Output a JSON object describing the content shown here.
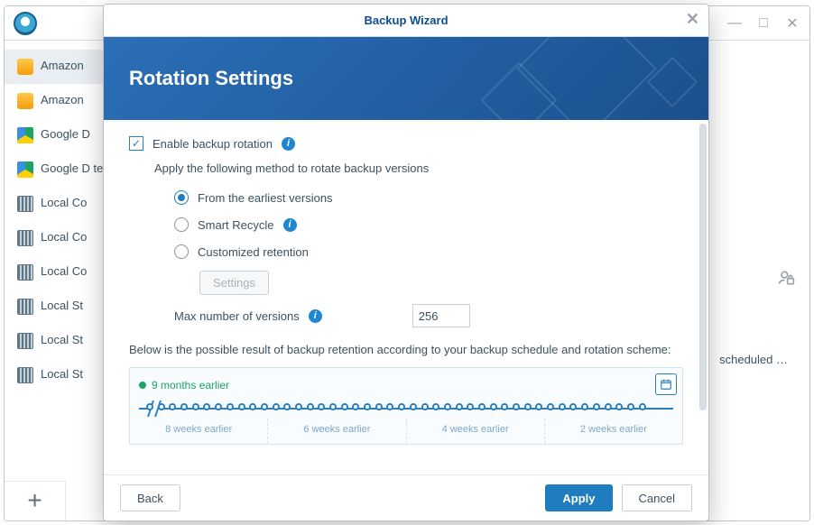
{
  "colors": {
    "accent": "#1f7dbf",
    "heroFrom": "#2b6fb6",
    "heroTo": "#1b4f8d",
    "green": "#1ea362"
  },
  "parentWindow": {
    "truncated_right_text": "scheduled …"
  },
  "sidebar": {
    "items": [
      {
        "label": "Amazon",
        "iconClass": "ic-amazon",
        "selected": true
      },
      {
        "label": "Amazon",
        "iconClass": "ic-amazon"
      },
      {
        "label": "Google D",
        "iconClass": "ic-gdrive"
      },
      {
        "label": "Google D test",
        "iconClass": "ic-gdrive"
      },
      {
        "label": "Local Co",
        "iconClass": "ic-local"
      },
      {
        "label": "Local Co",
        "iconClass": "ic-local"
      },
      {
        "label": "Local Co",
        "iconClass": "ic-local"
      },
      {
        "label": "Local St",
        "iconClass": "ic-local"
      },
      {
        "label": "Local St",
        "iconClass": "ic-local"
      },
      {
        "label": "Local St",
        "iconClass": "ic-local"
      }
    ]
  },
  "wizard": {
    "title": "Backup Wizard",
    "hero": "Rotation Settings",
    "enable_label": "Enable backup rotation",
    "enable_checked": true,
    "apply_hint": "Apply the following method to rotate backup versions",
    "options": {
      "earliest": "From the earliest versions",
      "smart": "Smart Recycle",
      "custom": "Customized retention",
      "selected": "earliest"
    },
    "settings_button": "Settings",
    "max_label": "Max number of versions",
    "max_value": "256",
    "result_hint": "Below is the possible result of backup retention according to your backup schedule and rotation scheme:",
    "viz": {
      "age_label": "9 months earlier",
      "ticks": [
        "8 weeks earlier",
        "6 weeks earlier",
        "4 weeks earlier",
        "2 weeks earlier"
      ]
    },
    "footer": {
      "back": "Back",
      "apply": "Apply",
      "cancel": "Cancel"
    }
  }
}
